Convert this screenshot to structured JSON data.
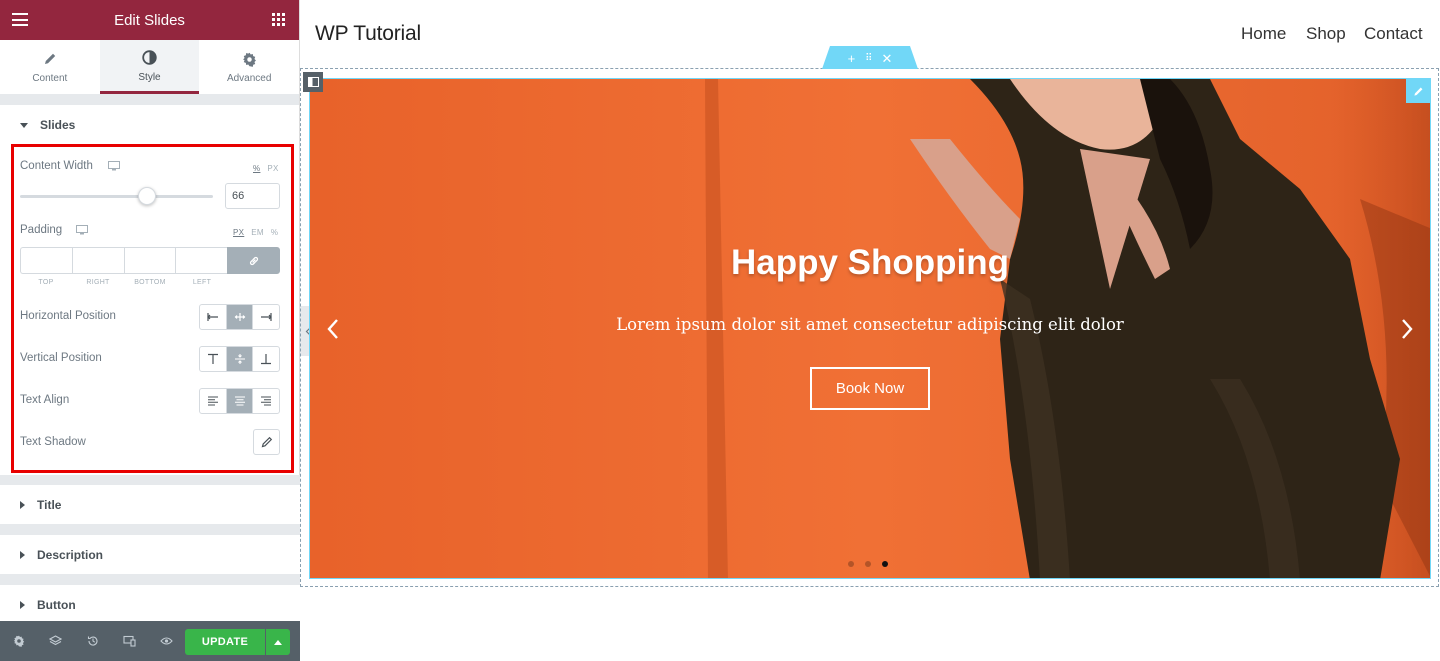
{
  "panel": {
    "title": "Edit Slides",
    "tabs": [
      {
        "label": "Content",
        "icon": "pencil-icon"
      },
      {
        "label": "Style",
        "icon": "half-circle-icon"
      },
      {
        "label": "Advanced",
        "icon": "gear-icon"
      }
    ],
    "active_tab": "Style",
    "slides_section": {
      "title": "Slides",
      "content_width": {
        "label": "Content Width",
        "units": [
          "%",
          "PX"
        ],
        "active_unit": "%",
        "value": "66",
        "slider_fraction": 0.66
      },
      "padding": {
        "label": "Padding",
        "units": [
          "PX",
          "EM",
          "%"
        ],
        "active_unit": "PX",
        "fields": [
          "TOP",
          "RIGHT",
          "BOTTOM",
          "LEFT"
        ]
      },
      "horizontal_position": {
        "label": "Horizontal Position",
        "selected": "center"
      },
      "vertical_position": {
        "label": "Vertical Position",
        "selected": "middle"
      },
      "text_align": {
        "label": "Text Align",
        "selected": "center"
      },
      "text_shadow": {
        "label": "Text Shadow"
      }
    },
    "sections": [
      "Title",
      "Description",
      "Button"
    ],
    "footer": {
      "update_label": "UPDATE"
    }
  },
  "site": {
    "title": "WP Tutorial",
    "nav": [
      "Home",
      "Shop",
      "Contact"
    ]
  },
  "slide": {
    "heading": "Happy Shopping",
    "description": "Lorem ipsum dolor sit amet consectetur adipiscing elit dolor",
    "button": "Book Now",
    "dots_count": 3,
    "active_dot": 3
  },
  "colors": {
    "brand": "#93263e",
    "highlight": "#e80000",
    "update": "#39b54a",
    "handle": "#71d7f7",
    "slide_bg": "#ee6a2c"
  }
}
